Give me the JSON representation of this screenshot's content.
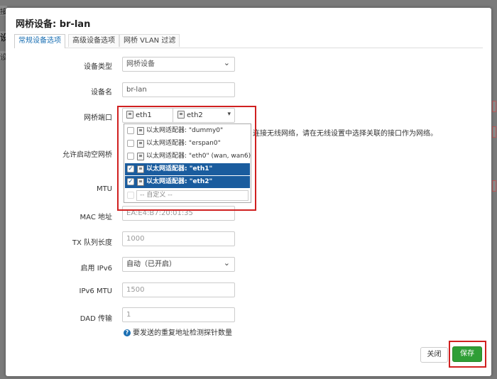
{
  "dialog": {
    "title": "网桥设备: br-lan",
    "tabs": [
      "常规设备选项",
      "高级设备选项",
      "网桥 VLAN 过滤"
    ],
    "active_tab": 0
  },
  "background": {
    "left_char_1": "接",
    "left_char_2": "设",
    "left_char_3": "设"
  },
  "form": {
    "device_type": {
      "label": "设备类型",
      "value": "网桥设备"
    },
    "device_name": {
      "label": "设备名",
      "value": "br-lan"
    },
    "bridge_ports": {
      "label": "网桥端口",
      "chips": [
        "eth1",
        "eth2"
      ],
      "help_tail": "连接无线网络，请在无线设置中选择关联的接口作为网络。"
    },
    "bring_up_empty": {
      "label": "允许启动空网桥"
    },
    "mtu": {
      "label": "MTU"
    },
    "mac": {
      "label": "MAC 地址",
      "placeholder": "EA:E4:B7:20:01:35"
    },
    "txqueuelen": {
      "label": "TX 队列长度",
      "placeholder": "1000"
    },
    "ipv6": {
      "label": "启用 IPv6",
      "value": "自动（已开启）"
    },
    "ipv6_mtu": {
      "label": "IPv6 MTU",
      "placeholder": "1500"
    },
    "dad": {
      "label": "DAD 传输",
      "placeholder": "1",
      "help": "要发送的重复地址检测探针数量"
    }
  },
  "dropdown": {
    "items": [
      {
        "label": "以太网适配器: \"dummy0\"",
        "checked": false
      },
      {
        "label": "以太网适配器: \"erspan0\"",
        "checked": false
      },
      {
        "label": "以太网适配器: \"eth0\" (wan, wan6)",
        "checked": false
      },
      {
        "label": "以太网适配器: \"eth1\"",
        "checked": true
      },
      {
        "label": "以太网适配器: \"eth2\"",
        "checked": true
      }
    ],
    "custom_placeholder": "-- 自定义 --"
  },
  "footer": {
    "close_label": "关闭",
    "save_label": "保存"
  },
  "colors": {
    "accent": "#1a6fb3",
    "selected": "#1a5c9e",
    "save": "#2f9e36",
    "highlight": "#d02020"
  }
}
